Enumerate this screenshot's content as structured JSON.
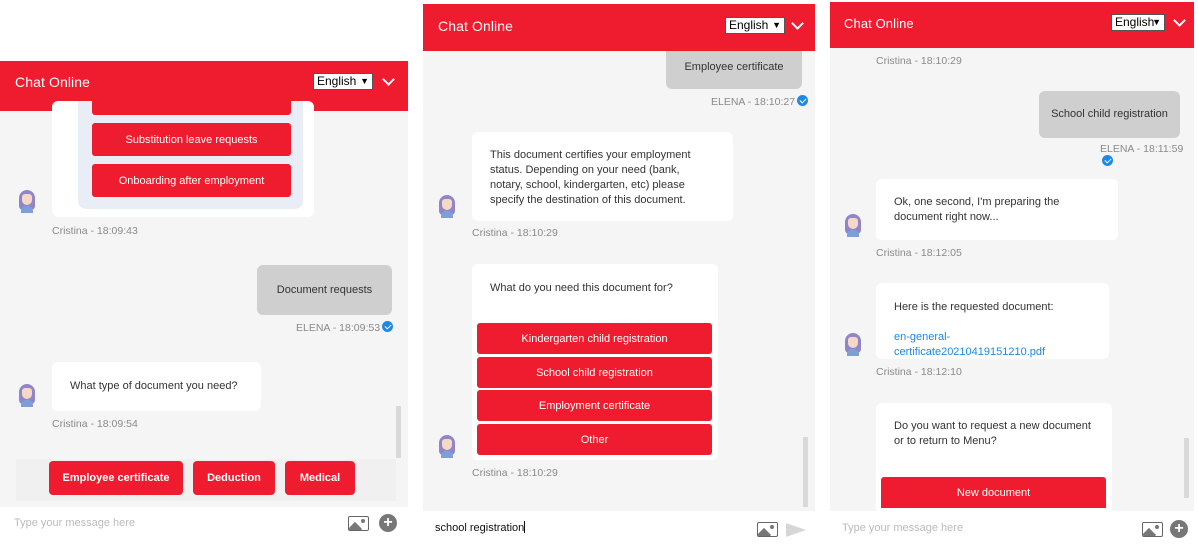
{
  "header": {
    "title": "Chat Online",
    "language": "English"
  },
  "input": {
    "placeholder": "Type your message here",
    "panel2_value": "school registration"
  },
  "panel1": {
    "menu_buttons": [
      "",
      "Substitution leave requests",
      "Onboarding after employment"
    ],
    "ts_menu": "Cristina - 18:09:43",
    "user_msg": "Document requests",
    "ts_user": "ELENA - 18:09:53",
    "bot_msg": "What type of document you need?",
    "ts_bot": "Cristina - 18:09:54",
    "quick_replies": [
      "Employee certificate",
      "Deduction",
      "Medical"
    ]
  },
  "panel2": {
    "user_msg": "Employee certificate",
    "ts_user": "ELENA - 18:10:27",
    "bot_msg": "This document certifies your employment status. Depending on your need (bank, notary, school, kindergarten, etc) please specify the destination of this document.",
    "ts_bot": "Cristina - 18:10:29",
    "question": "What do you need this document for?",
    "options": [
      "Kindergarten child registration",
      "School child registration",
      "Employment certificate",
      "Other"
    ],
    "ts_options": "Cristina - 18:10:29"
  },
  "panel3": {
    "ts_top": "Cristina - 18:10:29",
    "user_msg": "School child registration",
    "ts_user": "ELENA - 18:11:59",
    "bot_msg1": "Ok, one second, I'm preparing the document right now...",
    "ts_bot1": "Cristina - 18:12:05",
    "bot_msg2": "Here is the requested document:",
    "file_link": "en-general-certificate20210419151210.pdf",
    "ts_bot2": "Cristina - 18:12:10",
    "bot_msg3": "Do you want to request a new document or to return to Menu?",
    "new_doc_button": "New document"
  },
  "colors": {
    "accent": "#ee1c2e",
    "user_bubble": "#cfcfcf",
    "tick": "#1e88e5"
  }
}
